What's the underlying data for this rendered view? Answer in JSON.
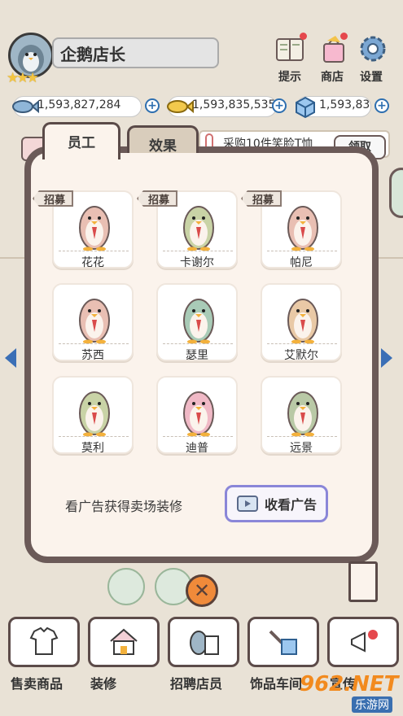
{
  "player": {
    "name": "企鹅店长",
    "stars": "★★★"
  },
  "top_menu": [
    {
      "label": "提示",
      "icon": "book-icon"
    },
    {
      "label": "商店",
      "icon": "shop-bag-icon"
    },
    {
      "label": "设置",
      "icon": "gear-icon"
    }
  ],
  "currency": [
    {
      "value": "1,593,827,284",
      "icon": "fish-icon"
    },
    {
      "value": "1,593,835,535",
      "icon": "gold-fish-icon"
    },
    {
      "value": "1,593,83",
      "icon": "ice-cube-icon"
    }
  ],
  "task_text": "采购10件笑脸T恤",
  "task_btn": "领取",
  "tabs": {
    "staff": "员工",
    "effect": "效果"
  },
  "recruit_label": "招募",
  "staff": [
    {
      "name": "花花",
      "body": "#e9bfb3",
      "recruit": true
    },
    {
      "name": "卡谢尔",
      "body": "#c9d3a6",
      "recruit": true
    },
    {
      "name": "帕尼",
      "body": "#e9bfb3",
      "recruit": true
    },
    {
      "name": "苏西",
      "body": "#e9bfb3",
      "recruit": false
    },
    {
      "name": "瑟里",
      "body": "#a9cbb7",
      "recruit": false
    },
    {
      "name": "艾默尔",
      "body": "#e9c9a6",
      "recruit": false
    },
    {
      "name": "莫利",
      "body": "#c9d3a6",
      "recruit": false
    },
    {
      "name": "迪普",
      "body": "#f0b9c6",
      "recruit": false
    },
    {
      "name": "远景",
      "body": "#b9c9a6",
      "recruit": false
    }
  ],
  "ad_text": "看广告获得卖场装修",
  "ad_button": "收看广告",
  "bottom_nav": [
    {
      "label": "售卖商品",
      "icon": "tshirt-icon"
    },
    {
      "label": "装修",
      "icon": "house-icon"
    },
    {
      "label": "招聘店员",
      "icon": "penguin-resume-icon"
    },
    {
      "label": "饰品车间",
      "icon": "tools-icon"
    },
    {
      "label": "宣传",
      "icon": "megaphone-icon"
    }
  ],
  "watermark": {
    "brand": "962.NET",
    "sub": "乐游网"
  },
  "colors": {
    "panel_border": "#6b5a58",
    "ad_border": "#8a86d8",
    "plus_blue": "#2e6fb0"
  }
}
